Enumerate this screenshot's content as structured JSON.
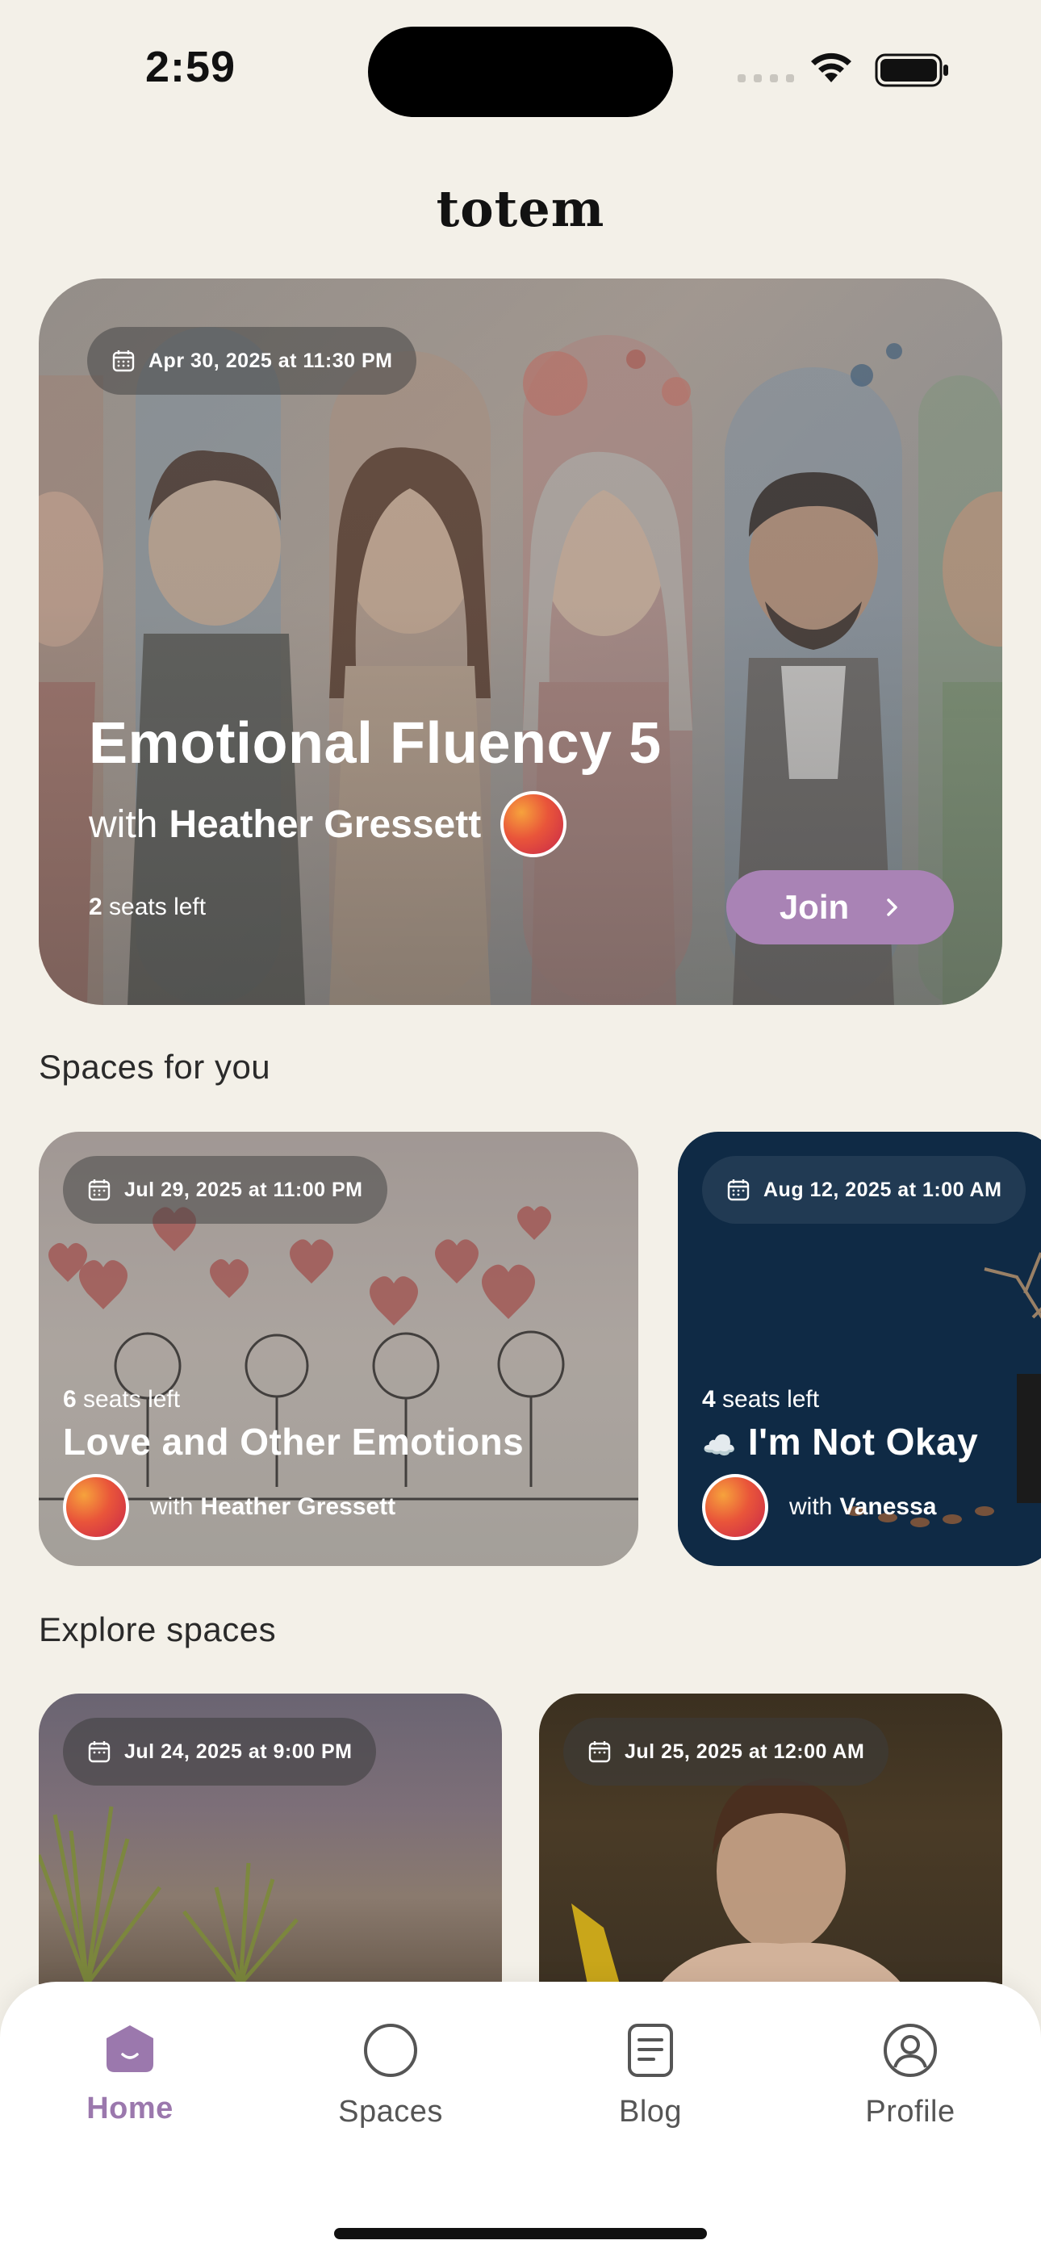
{
  "status_bar": {
    "time": "2:59"
  },
  "app": {
    "logo": "totem"
  },
  "hero": {
    "date": "Apr 30, 2025 at 11:30 PM",
    "title": "Emotional Fluency 5",
    "host_prefix": "with",
    "host_name": "Heather Gressett",
    "seats_count": "2",
    "seats_label": "seats left",
    "join_label": "Join",
    "join_icon": "chevron-right-icon"
  },
  "sections": {
    "spaces_for_you": "Spaces for you",
    "explore_spaces": "Explore spaces"
  },
  "spaces_for_you": [
    {
      "date": "Jul 29, 2025 at 11:00 PM",
      "seats_count": "6",
      "seats_label": "seats left",
      "title": "Love and Other Emotions",
      "host_prefix": "with",
      "host_name": "Heather Gressett"
    },
    {
      "date": "Aug 12, 2025 at 1:00 AM",
      "seats_count": "4",
      "seats_label": "seats left",
      "title_emoji": "☁️",
      "title": "I'm Not Okay",
      "host_prefix": "with",
      "host_name": "Vanessa"
    }
  ],
  "explore_spaces": [
    {
      "date": "Jul 24, 2025 at 9:00 PM"
    },
    {
      "date": "Jul 25, 2025 at 12:00 AM"
    }
  ],
  "tabs": [
    {
      "label": "Home",
      "icon": "home-icon",
      "active": true
    },
    {
      "label": "Spaces",
      "icon": "circle-icon",
      "active": false
    },
    {
      "label": "Blog",
      "icon": "document-icon",
      "active": false
    },
    {
      "label": "Profile",
      "icon": "profile-icon",
      "active": false
    }
  ],
  "colors": {
    "background": "#f3f0e8",
    "accent": "#9b78ad",
    "join_button": "#a983b5",
    "dark_card": "#0f2a45"
  }
}
